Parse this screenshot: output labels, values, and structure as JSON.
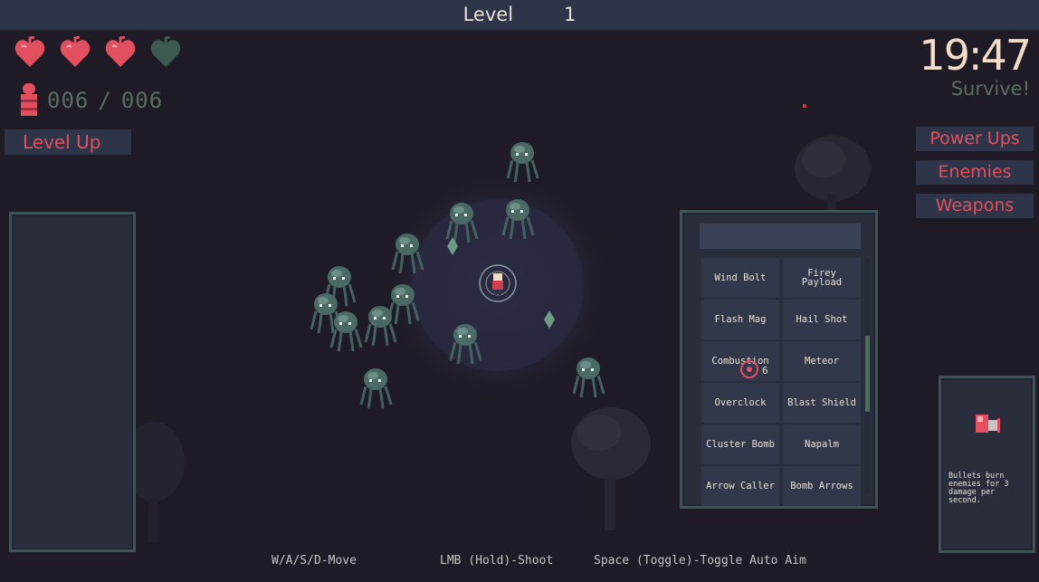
{
  "top_bar": {
    "label": "Level",
    "level": "1"
  },
  "player": {
    "hearts": [
      {
        "state": "full"
      },
      {
        "state": "full"
      },
      {
        "state": "full"
      },
      {
        "state": "empty"
      }
    ]
  },
  "ammo": {
    "current": "006",
    "sep": "/",
    "max": "006"
  },
  "level_up_label": "Level Up",
  "timer": "19:47",
  "objective": "Survive!",
  "menu": {
    "power_ups": "Power Ups",
    "enemies": "Enemies",
    "weapons": "Weapons"
  },
  "weapons_list": [
    {
      "name": "Wind Bolt"
    },
    {
      "name": "Firey\nPayload"
    },
    {
      "name": "Flash Mag"
    },
    {
      "name": "Hail Shot"
    },
    {
      "name": "Combustion"
    },
    {
      "name": "Meteor"
    },
    {
      "name": "Overclock"
    },
    {
      "name": "Blast Shield"
    },
    {
      "name": "Cluster Bomb"
    },
    {
      "name": "Napalm"
    },
    {
      "name": "Arrow Caller"
    },
    {
      "name": "Bomb Arrows"
    }
  ],
  "selected_count": "6",
  "detail": {
    "description": "Bullets burn enemies for 3 damage per second."
  },
  "hints": {
    "move": "W/A/S/D-Move",
    "shoot": "LMB (Hold)-Shoot",
    "aim": "Space (Toggle)-Toggle Auto Aim"
  },
  "colors": {
    "accent_red": "#e2505f",
    "panel": "#2a2e3c",
    "border": "#3d5456",
    "muted_green": "#5b6e62"
  }
}
